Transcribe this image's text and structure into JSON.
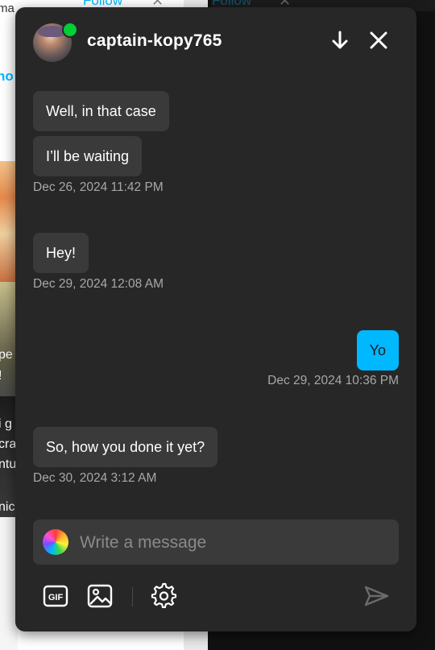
{
  "background": {
    "follow_label": "Follow",
    "follow_label_2": "Follow",
    "close_glyph": "✕",
    "partial_text_top": "ma",
    "partial_link": "ho",
    "side_fragments": [
      "pe",
      "!",
      "i g",
      "cra",
      "ntu",
      "nic"
    ]
  },
  "chat": {
    "username": "captain-kopy765",
    "online": true,
    "messages": [
      {
        "text": "Well, in that case",
        "from": "other"
      },
      {
        "text": "I’ll be waiting",
        "from": "other",
        "timestamp": "Dec 26, 2024 11:42 PM"
      },
      {
        "text": "Hey!",
        "from": "other",
        "timestamp": "Dec 29, 2024 12:08 AM"
      },
      {
        "text": "Yo",
        "from": "me",
        "timestamp": "Dec 29, 2024 10:36 PM"
      },
      {
        "text": "So, how you done it yet?",
        "from": "other",
        "timestamp": "Dec 30, 2024 3:12 AM"
      }
    ],
    "composer": {
      "placeholder": "Write a message",
      "value": ""
    },
    "toolbar": {
      "gif_label": "GIF"
    }
  },
  "colors": {
    "panel": "#272727",
    "bubble_other": "#3a3a3a",
    "bubble_mine": "#00b8ff",
    "online": "#00cf35",
    "link": "#00b8ff"
  },
  "icons": [
    "arrow-down-icon",
    "close-icon",
    "gif-icon",
    "image-icon",
    "gear-icon",
    "send-icon"
  ]
}
